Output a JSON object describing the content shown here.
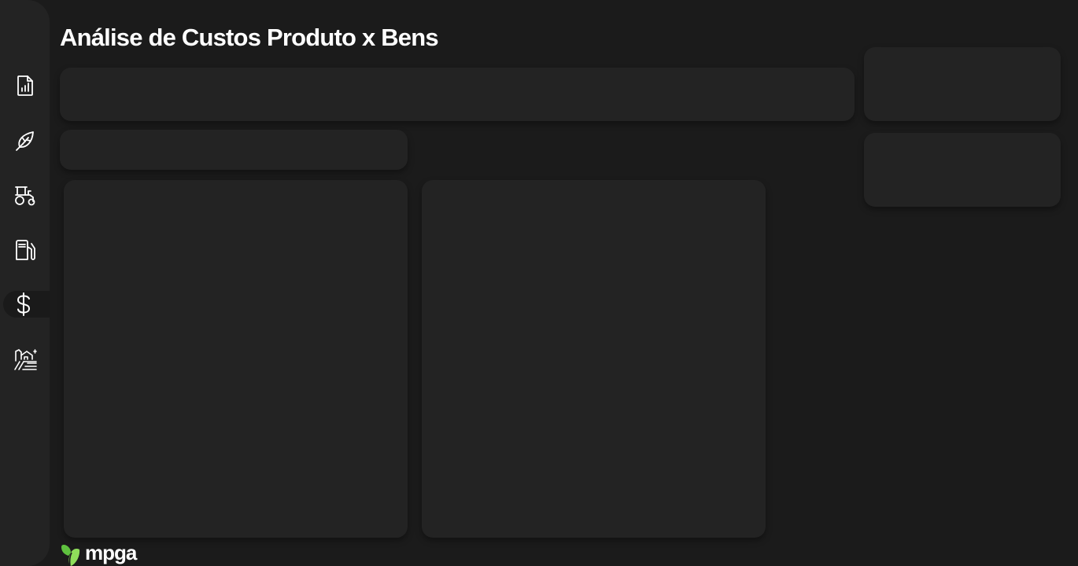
{
  "page": {
    "title": "Análise de Custos Produto x Bens"
  },
  "sidebar": {
    "items": [
      {
        "id": "reports",
        "icon": "report-chart-icon",
        "active": false
      },
      {
        "id": "crops",
        "icon": "leaf-icon",
        "active": false
      },
      {
        "id": "machinery",
        "icon": "tractor-icon",
        "active": false
      },
      {
        "id": "fuel",
        "icon": "fuel-pump-icon",
        "active": false
      },
      {
        "id": "costs",
        "icon": "dollar-icon",
        "active": true
      },
      {
        "id": "farm",
        "icon": "farm-field-icon",
        "active": false
      }
    ]
  },
  "brand": {
    "name": "mpga",
    "logo_icon": "mpga-leaf-logo",
    "colors": {
      "logo_green": "#5fc13f",
      "logo_green_light": "#8fde5a"
    }
  },
  "theme": {
    "background": "#1b1b1b",
    "panel": "#232323",
    "text": "#ffffff"
  }
}
